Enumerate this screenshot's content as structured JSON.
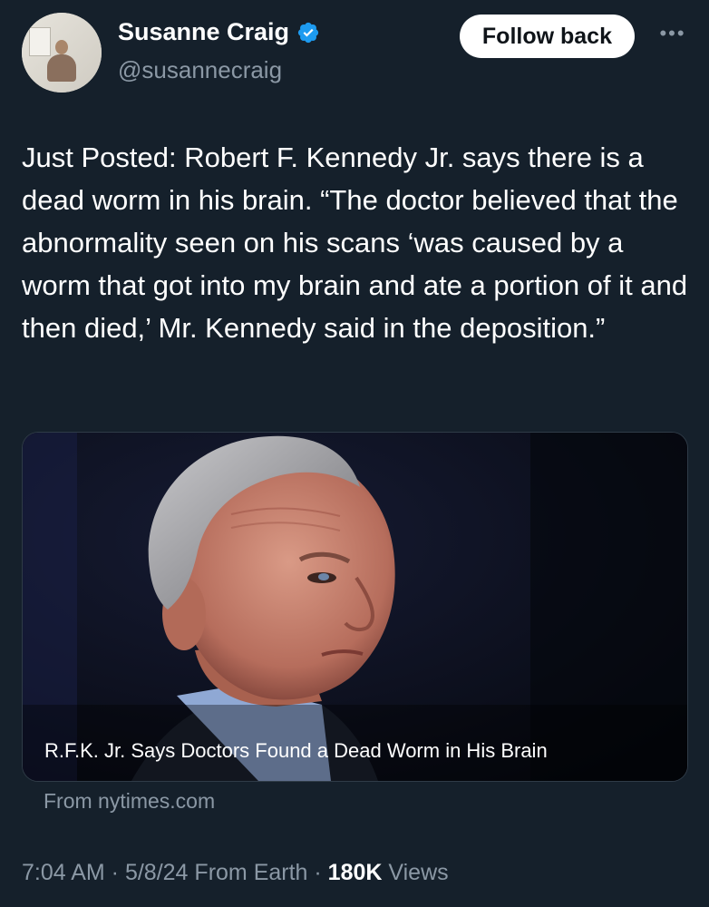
{
  "author": {
    "name": "Susanne Craig",
    "handle": "@susannecraig"
  },
  "follow_button": {
    "label": "Follow back"
  },
  "more_menu": {
    "icon": "more-horizontal-icon",
    "glyph": "•••"
  },
  "tweet": {
    "text": "Just Posted: Robert F. Kennedy Jr. says there is a dead worm in his brain. “The doctor believed that the abnormality seen on his scans ‘was caused by a worm that got into my brain and ate a portion of it and then died,’ Mr. Kennedy said in the deposition.”"
  },
  "card": {
    "headline": "R.F.K. Jr. Says Doctors Found a Dead Worm in His Brain",
    "source": "From nytimes.com"
  },
  "meta": {
    "time": "7:04 AM",
    "date": "5/8/24",
    "location": "From Earth",
    "views_count": "180K",
    "views_label": "Views",
    "separator": " · "
  },
  "colors": {
    "background": "#15202b",
    "secondary_text": "#8b98a5",
    "verified_blue": "#1d9bf0"
  }
}
